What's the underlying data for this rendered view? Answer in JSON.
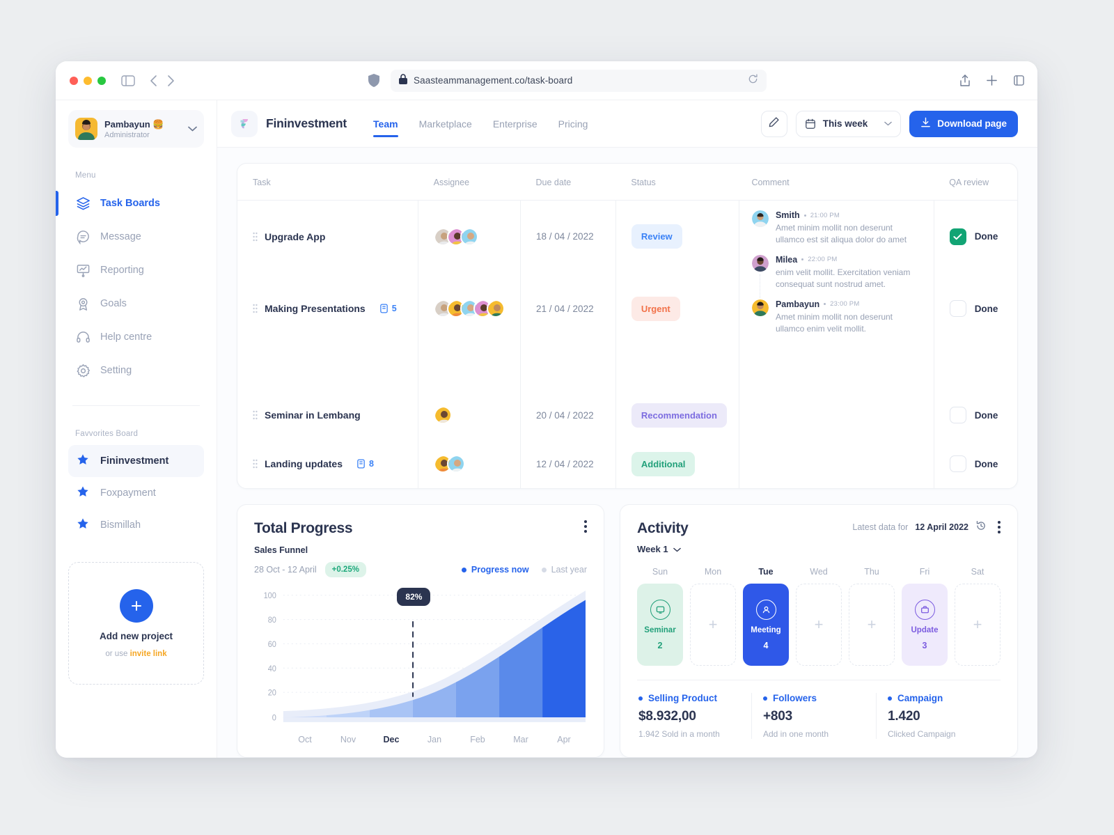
{
  "browser": {
    "url": "Saasteammanagement.co/task-board",
    "icons": {
      "shield": "shield-icon",
      "lock": "lock-icon",
      "reload": "reload-icon",
      "share": "share-icon",
      "new_tab": "plus-icon",
      "tabs": "tabs-icon",
      "sidebar": "sidebar-toggle-icon",
      "back": "back-arrow-icon",
      "forward": "forward-arrow-icon"
    }
  },
  "sidebar": {
    "profile": {
      "name": "Pambayun 🍔",
      "role": "Administrator"
    },
    "menu_label": "Menu",
    "menu": [
      {
        "label": "Task Boards",
        "icon": "layers-icon",
        "active": true
      },
      {
        "label": "Message",
        "icon": "message-icon",
        "active": false
      },
      {
        "label": "Reporting",
        "icon": "presentation-chart-icon",
        "active": false
      },
      {
        "label": "Goals",
        "icon": "award-icon",
        "active": false
      },
      {
        "label": "Help centre",
        "icon": "headphones-icon",
        "active": false
      },
      {
        "label": "Setting",
        "icon": "gear-icon",
        "active": false
      }
    ],
    "favourites_label": "Favvorites Board",
    "favourites": [
      {
        "label": "Fininvestment",
        "active": true
      },
      {
        "label": "Foxpayment",
        "active": false
      },
      {
        "label": "Bismillah",
        "active": false
      }
    ],
    "add_project": {
      "title": "Add new project",
      "hint_prefix": "or use ",
      "hint_link": "invite link"
    }
  },
  "topbar": {
    "brand": "Fininvestment",
    "tabs": [
      {
        "label": "Team",
        "active": true
      },
      {
        "label": "Marketplace",
        "active": false
      },
      {
        "label": "Enterprise",
        "active": false
      },
      {
        "label": "Pricing",
        "active": false
      }
    ],
    "edit_icon": "pencil-icon",
    "week_select": "This week",
    "download_label": "Download page"
  },
  "table": {
    "columns": [
      "Task",
      "Assignee",
      "Due date",
      "Status",
      "Comment",
      "QA review"
    ],
    "rows": [
      {
        "task": "Upgrade App",
        "attachments": null,
        "assignees": 3,
        "due": "18 / 04 / 2022",
        "status": "Review",
        "status_kind": "b-review",
        "qa": "Done",
        "qa_done": true
      },
      {
        "task": "Making Presentations",
        "attachments": "5",
        "assignees": 5,
        "due": "21 / 04 / 2022",
        "status": "Urgent",
        "status_kind": "b-urgent",
        "qa": "Done",
        "qa_done": false
      },
      {
        "task": "Seminar in Lembang",
        "attachments": null,
        "assignees": 1,
        "due": "20 / 04 / 2022",
        "status": "Recommendation",
        "status_kind": "b-recom",
        "qa": "Done",
        "qa_done": false
      },
      {
        "task": "Landing updates",
        "attachments": "8",
        "assignees": 2,
        "due": "12 / 04 / 2022",
        "status": "Additional",
        "status_kind": "b-add",
        "qa": "Done",
        "qa_done": false
      }
    ],
    "comments": [
      {
        "name": "Smith",
        "time": "21:00 PM",
        "body": "Amet minim mollit non deserunt ullamco est sit aliqua dolor do amet"
      },
      {
        "name": "Milea",
        "time": "22:00 PM",
        "body": "enim velit mollit. Exercitation veniam consequat sunt nostrud amet."
      },
      {
        "name": "Pambayun",
        "time": "23:00 PM",
        "body": "Amet minim mollit non deserunt ullamco enim velit mollit."
      }
    ]
  },
  "progress": {
    "title": "Total Progress",
    "subtitle": "Sales Funnel",
    "range": "28 Oct - 12 April",
    "delta": "+0.25%",
    "legend_now": "Progress now",
    "legend_last": "Last year",
    "tooltip": "82%"
  },
  "chart_data": {
    "type": "area",
    "title": "Total Progress",
    "subtitle": "Sales Funnel",
    "xlabel": "",
    "ylabel": "",
    "ylim": [
      0,
      100
    ],
    "yticks": [
      0,
      20,
      40,
      60,
      80,
      100
    ],
    "grid": true,
    "legend_position": "top-right",
    "categories": [
      "Oct",
      "Nov",
      "Dec",
      "Jan",
      "Feb",
      "Mar",
      "Apr"
    ],
    "highlight_category": "Dec",
    "annotation": {
      "label": "82%",
      "at_category": "Dec"
    },
    "series": [
      {
        "name": "Progress now",
        "color": "#2563eb",
        "values": [
          10,
          12,
          16,
          22,
          34,
          54,
          82
        ]
      },
      {
        "name": "Last year",
        "color": "#d6dbe6",
        "values": [
          14,
          16,
          20,
          27,
          40,
          62,
          92
        ]
      }
    ]
  },
  "activity": {
    "title": "Activity",
    "latest_prefix": "Latest data for",
    "latest_date": "12 April 2022",
    "refresh_icon": "history-icon",
    "week": "Week 1",
    "days": [
      {
        "name": "Sun",
        "today": false,
        "event": {
          "label": "Seminar",
          "count": "2",
          "kind": "s-green",
          "icon": "monitor-icon"
        }
      },
      {
        "name": "Mon",
        "today": false,
        "event": null
      },
      {
        "name": "Tue",
        "today": true,
        "event": {
          "label": "Meeting",
          "count": "4",
          "kind": "s-blue",
          "icon": "users-icon"
        }
      },
      {
        "name": "Wed",
        "today": false,
        "event": null
      },
      {
        "name": "Thu",
        "today": false,
        "event": null
      },
      {
        "name": "Fri",
        "today": false,
        "event": {
          "label": "Update",
          "count": "3",
          "kind": "s-purple",
          "icon": "briefcase-icon"
        }
      },
      {
        "name": "Sat",
        "today": false,
        "event": null
      }
    ],
    "stats": [
      {
        "label": "Selling Product",
        "value": "$8.932,00",
        "sub": "1.942 Sold in a month"
      },
      {
        "label": "Followers",
        "value": "+803",
        "sub": "Add in one month"
      },
      {
        "label": "Campaign",
        "value": "1.420",
        "sub": "Clicked Campaign"
      }
    ]
  },
  "colors": {
    "accent": "#2563eb",
    "green": "#12a474",
    "orange": "#f2724a",
    "purple": "#7c6ce0",
    "ink": "#2b3450",
    "muted": "#98a1b4"
  }
}
